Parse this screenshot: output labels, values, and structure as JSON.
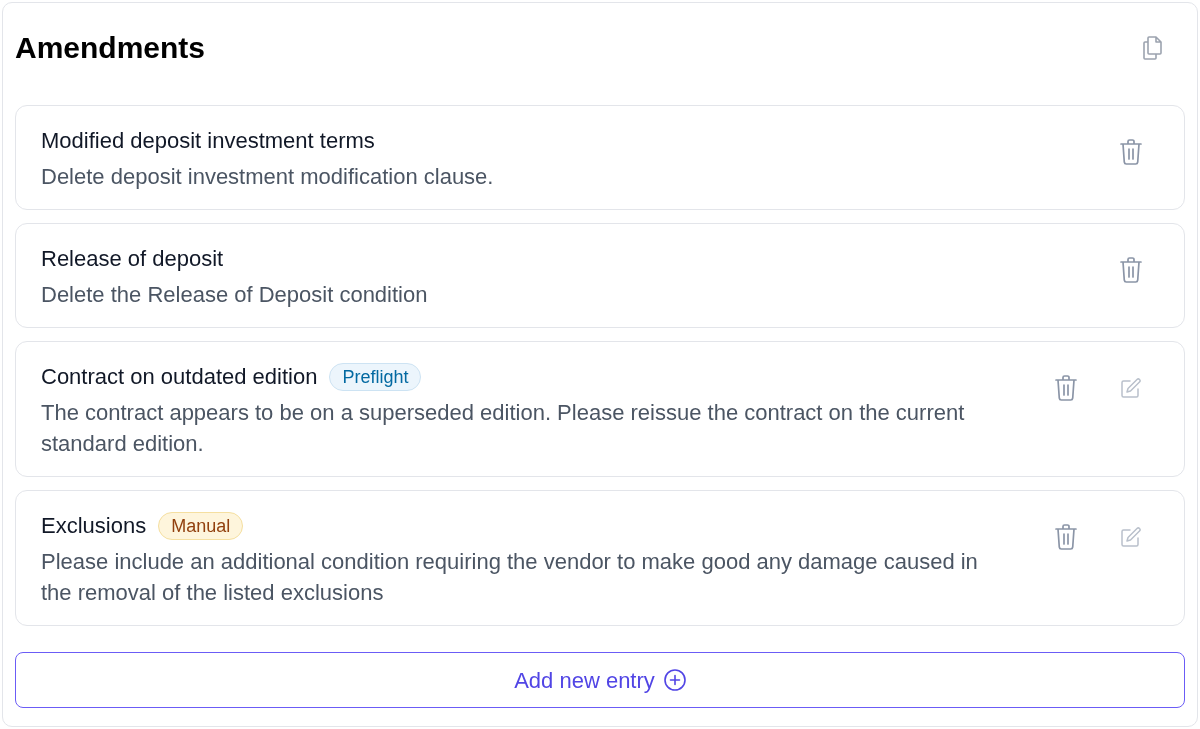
{
  "panel": {
    "title": "Amendments"
  },
  "entries": [
    {
      "title": "Modified deposit investment terms",
      "description": "Delete deposit investment modification clause.",
      "editable": false
    },
    {
      "title": "Release of deposit",
      "description": "Delete the Release of Deposit condition",
      "editable": false
    },
    {
      "title": "Contract on outdated edition",
      "badge": {
        "label": "Preflight",
        "kind": "info"
      },
      "description": "The contract appears to be on a superseded edition. Please reissue the contract on the current standard edition.",
      "editable": true
    },
    {
      "title": "Exclusions",
      "badge": {
        "label": "Manual",
        "kind": "warning"
      },
      "description": "Please include an additional condition requiring the vendor to make good any damage caused in the removal of the listed exclusions",
      "editable": true
    }
  ],
  "add_button": {
    "label": "Add new entry"
  }
}
